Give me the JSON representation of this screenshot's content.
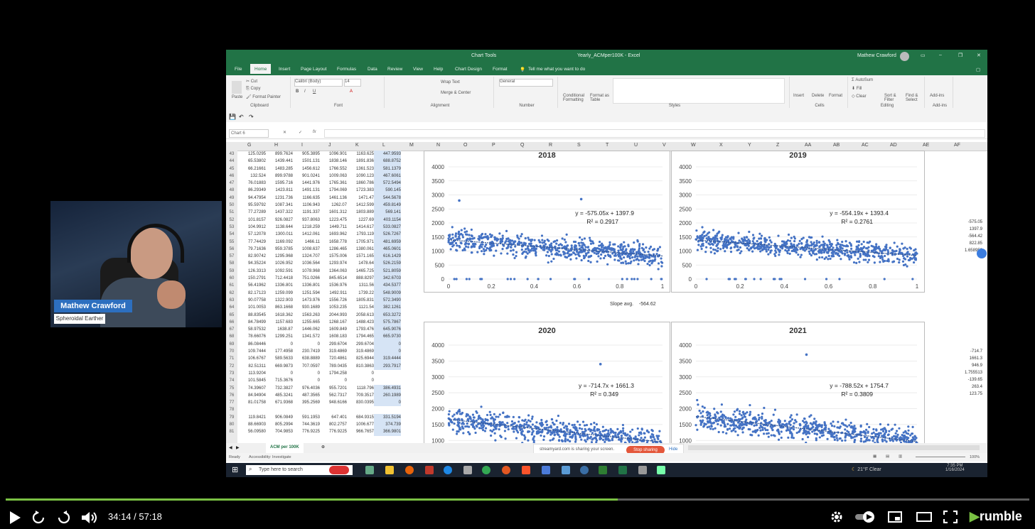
{
  "webcam": {
    "name": "Mathew Crawford",
    "subtitle": "Spheroidal Earther"
  },
  "excel": {
    "title": "Yearly_ACMper100K - Excel",
    "context_tab": "Chart Tools",
    "user": "Mathew Crawford",
    "tabs": [
      "File",
      "Home",
      "Insert",
      "Page Layout",
      "Formulas",
      "Data",
      "Review",
      "View",
      "Help",
      "Chart Design",
      "Format"
    ],
    "tellme": "Tell me what you want to do",
    "ribbon_groups": [
      "Clipboard",
      "Font",
      "Alignment",
      "Number",
      "Styles",
      "Cells",
      "Editing",
      "Add-ins"
    ],
    "ribbon_buttons": {
      "cut": "Cut",
      "copy": "Copy",
      "format_painter": "Format Painter",
      "paste": "Paste",
      "font_name": "Calibri (Body)",
      "font_size": "14",
      "wrap": "Wrap Text",
      "merge": "Merge & Center",
      "number_format": "General",
      "cond_format": "Conditional Formatting",
      "format_table": "Format as Table",
      "insert": "Insert",
      "delete": "Delete",
      "format": "Format",
      "autosum": "AutoSum",
      "fill": "Fill",
      "clear": "Clear",
      "sort": "Sort & Filter",
      "find": "Find & Select",
      "addins": "Add-ins"
    },
    "name_box": "Chart 6",
    "columns": [
      "G",
      "H",
      "I",
      "J",
      "K",
      "L",
      "M",
      "N",
      "O",
      "P",
      "Q",
      "R",
      "S",
      "T",
      "U",
      "V",
      "W",
      "X",
      "Y",
      "Z",
      "AA",
      "AB",
      "AC",
      "AD",
      "AE",
      "AF"
    ],
    "rows": [
      {
        "n": "43",
        "v": [
          "125.0295",
          "899.7624",
          "905.3895",
          "1096.901",
          "1163.625",
          "447.9593"
        ]
      },
      {
        "n": "44",
        "v": [
          "65.53802",
          "1439.441",
          "1501.131",
          "1838.146",
          "1891.836",
          "688.8752"
        ]
      },
      {
        "n": "45",
        "v": [
          "66.21661",
          "1483.285",
          "1456.612",
          "1766.552",
          "1361.523",
          "581.1379"
        ]
      },
      {
        "n": "46",
        "v": [
          "132.524",
          "899.9788",
          "901.0241",
          "1009.063",
          "1090.123",
          "467.6061"
        ]
      },
      {
        "n": "47",
        "v": [
          "76.01883",
          "1595.716",
          "1441.976",
          "1765.361",
          "1860.786",
          "572.5494"
        ]
      },
      {
        "n": "48",
        "v": [
          "86.29349",
          "1423.811",
          "1491.131",
          "1794.069",
          "1723.383",
          "590.145"
        ]
      },
      {
        "n": "49",
        "v": [
          "94.47954",
          "1231.736",
          "1166.635",
          "1461.136",
          "1471.47",
          "544.5678"
        ]
      },
      {
        "n": "50",
        "v": [
          "95.59792",
          "1087.341",
          "1106.943",
          "1262.07",
          "1412.599",
          "459.8149"
        ]
      },
      {
        "n": "51",
        "v": [
          "77.27289",
          "1437.322",
          "1191.337",
          "1601.312",
          "1803.889",
          "569.141"
        ]
      },
      {
        "n": "52",
        "v": [
          "101.8157",
          "926.0827",
          "937.8063",
          "1223.475",
          "1227.69",
          "403.1154"
        ]
      },
      {
        "n": "53",
        "v": [
          "104.9912",
          "1138.644",
          "1218.259",
          "1449.711",
          "1414.617",
          "533.0827"
        ]
      },
      {
        "n": "54",
        "v": [
          "57.12078",
          "1300.011",
          "1412.061",
          "1693.962",
          "1793.119",
          "526.7267"
        ]
      },
      {
        "n": "55",
        "v": [
          "77.74429",
          "1169.092",
          "1466.11",
          "1658.778",
          "1705.971",
          "481.6959"
        ]
      },
      {
        "n": "56",
        "v": [
          "79.71636",
          "959.3785",
          "1008.637",
          "1286.465",
          "1380.061",
          "465.0601"
        ]
      },
      {
        "n": "57",
        "v": [
          "82.90742",
          "1295.968",
          "1324.707",
          "1575.006",
          "1571.165",
          "616.1429"
        ]
      },
      {
        "n": "58",
        "v": [
          "94.35224",
          "1026.952",
          "1036.564",
          "1293.974",
          "1478.64",
          "526.2159"
        ]
      },
      {
        "n": "59",
        "v": [
          "126.3313",
          "1092.591",
          "1078.968",
          "1364.063",
          "1465.725",
          "521.8059"
        ]
      },
      {
        "n": "60",
        "v": [
          "150.2791",
          "712.4418",
          "751.0266",
          "845.6514",
          "888.8297",
          "342.6703"
        ]
      },
      {
        "n": "61",
        "v": [
          "56.41962",
          "1336.801",
          "1336.801",
          "1536.976",
          "1311.56",
          "434.5377"
        ]
      },
      {
        "n": "62",
        "v": [
          "82.17123",
          "1259.099",
          "1251.594",
          "1492.911",
          "1739.22",
          "548.9009"
        ]
      },
      {
        "n": "63",
        "v": [
          "90.07758",
          "1322.903",
          "1473.976",
          "1556.726",
          "1805.831",
          "572.3490"
        ]
      },
      {
        "n": "64",
        "v": [
          "101.0053",
          "863.1668",
          "930.1689",
          "1053.235",
          "1121.54",
          "382.1261"
        ]
      },
      {
        "n": "65",
        "v": [
          "88.83545",
          "1618.362",
          "1563.263",
          "2044.993",
          "2058.613",
          "653.3272"
        ]
      },
      {
        "n": "66",
        "v": [
          "84.78499",
          "1157.683",
          "1255.665",
          "1268.167",
          "1488.423",
          "575.7867"
        ]
      },
      {
        "n": "67",
        "v": [
          "58.97532",
          "1638.87",
          "1446.062",
          "1609.849",
          "1793.476",
          "645.9076"
        ]
      },
      {
        "n": "68",
        "v": [
          "78.66076",
          "1299.251",
          "1341.572",
          "1608.183",
          "1794.465",
          "665.9730"
        ]
      },
      {
        "n": "69",
        "v": [
          "86.08446",
          "0",
          "0",
          "299.6704",
          "299.6704",
          "0"
        ]
      },
      {
        "n": "70",
        "v": [
          "109.7444",
          "177.4958",
          "230.7419",
          "319.4869",
          "319.4869",
          "0"
        ]
      },
      {
        "n": "71",
        "v": [
          "106.6767",
          "589.5633",
          "638.8889",
          "720.4861",
          "825.6944",
          "319.4444"
        ]
      },
      {
        "n": "72",
        "v": [
          "82.51311",
          "669.9873",
          "707.0597",
          "789.0435",
          "810.3863",
          "293.7917"
        ]
      },
      {
        "n": "73",
        "v": [
          "113.9204",
          "0",
          "0",
          "1794.258",
          "0",
          ""
        ]
      },
      {
        "n": "74",
        "v": [
          "101.5845",
          "715.3676",
          "0",
          "0",
          "0",
          ""
        ]
      },
      {
        "n": "75",
        "v": [
          "74.39607",
          "732.3827",
          "976.4036",
          "955.7201",
          "1118.796",
          "386.4931"
        ]
      },
      {
        "n": "76",
        "v": [
          "84.94904",
          "485.3241",
          "487.3565",
          "562.7317",
          "709.3517",
          "260.1989"
        ]
      },
      {
        "n": "77",
        "v": [
          "81.01758",
          "671.9368",
          "395.2569",
          "948.6166",
          "830.0395",
          "0"
        ]
      },
      {
        "n": "78",
        "v": [
          "",
          "",
          "",
          "",
          "",
          ""
        ]
      },
      {
        "n": "79",
        "v": [
          "119.8421",
          "906.0849",
          "591.1953",
          "647.401",
          "684.9315",
          "331.5194"
        ]
      },
      {
        "n": "80",
        "v": [
          "88.66903",
          "805.2994",
          "744.3619",
          "802.2757",
          "1006.677",
          "374.739"
        ]
      },
      {
        "n": "81",
        "v": [
          "56.09580",
          "704.9853",
          "776.9225",
          "776.9225",
          "966.7657",
          "366.9801"
        ]
      }
    ],
    "slope_label": "Slope avg.",
    "slope_value": "-564.62",
    "right_values_top": [
      "-575.05",
      "1397.9",
      "-564.42",
      "822.85",
      "1.658952"
    ],
    "right_values_bottom": [
      "-714.7",
      "1661.3",
      "946.9",
      "1.755513",
      "-139.65",
      "263.4",
      "123.75"
    ],
    "sheet_tab": "ACM per 100K",
    "status_ready": "Ready",
    "status_access": "Accessibility: Investigate",
    "zoom": "100%",
    "share_text": "streamyard.com is sharing your screen.",
    "stop_sharing": "Stop sharing",
    "hide": "Hide"
  },
  "taskbar": {
    "search_placeholder": "Type here to search",
    "weather": "21°F Clear",
    "time": "7:35 PM",
    "date": "1/16/2024"
  },
  "player": {
    "time": "34:14 / 57:18",
    "progress": 0.598,
    "brand": "rumble"
  },
  "chart_data": [
    {
      "type": "scatter",
      "title": "2018",
      "xlim": [
        0,
        1
      ],
      "ylim": [
        0,
        4000
      ],
      "xticks": [
        "0",
        "0.2",
        "0.4",
        "0.6",
        "0.8",
        "1"
      ],
      "yticks": [
        "0",
        "500",
        "1000",
        "1500",
        "2000",
        "2500",
        "3000",
        "3500",
        "4000"
      ],
      "trend": {
        "slope": -575.05,
        "intercept": 1397.9
      },
      "equation": "y = -575.05x + 1397.9",
      "r2": "R² = 0.2917",
      "color": "#4472c4"
    },
    {
      "type": "scatter",
      "title": "2019",
      "xlim": [
        0,
        1
      ],
      "ylim": [
        0,
        4000
      ],
      "xticks": [
        "0",
        "0.2",
        "0.4",
        "0.6",
        "0.8",
        "1"
      ],
      "yticks": [
        "0",
        "500",
        "1000",
        "1500",
        "2000",
        "2500",
        "3000",
        "3500",
        "4000"
      ],
      "trend": {
        "slope": -554.19,
        "intercept": 1393.4
      },
      "equation": "y = -554.19x + 1393.4",
      "r2": "R² = 0.2761",
      "color": "#4472c4"
    },
    {
      "type": "scatter",
      "title": "2020",
      "xlim": [
        0,
        1
      ],
      "ylim": [
        0,
        4000
      ],
      "yticks": [
        "500",
        "1000",
        "1500",
        "2000",
        "2500",
        "3000",
        "3500",
        "4000"
      ],
      "trend": {
        "slope": -714.7,
        "intercept": 1661.3
      },
      "equation": "y = -714.7x + 1661.3",
      "r2": "R² = 0.349",
      "color": "#4472c4"
    },
    {
      "type": "scatter",
      "title": "2021",
      "xlim": [
        0,
        1
      ],
      "ylim": [
        0,
        4000
      ],
      "yticks": [
        "500",
        "1000",
        "1500",
        "2000",
        "2500",
        "3000",
        "3500",
        "4000"
      ],
      "trend": {
        "slope": -788.52,
        "intercept": 1754.7
      },
      "equation": "y = -788.52x + 1754.7",
      "r2": "R² = 0.3809",
      "color": "#4472c4"
    }
  ]
}
